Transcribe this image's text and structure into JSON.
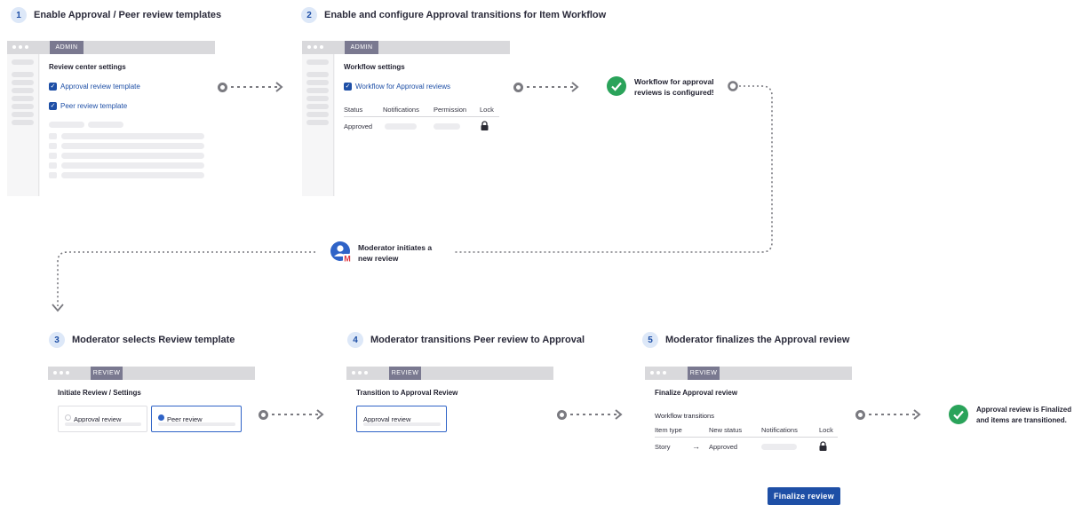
{
  "steps": [
    {
      "num": "1",
      "label": "Enable Approval / Peer review templates"
    },
    {
      "num": "2",
      "label": "Enable and configure Approval transitions for Item Workflow"
    },
    {
      "num": "3",
      "label": "Moderator selects Review template"
    },
    {
      "num": "4",
      "label": "Moderator transitions Peer review to Approval"
    },
    {
      "num": "5",
      "label": "Moderator finalizes the Approval review"
    }
  ],
  "panel1": {
    "tab": "ADMIN",
    "title": "Review center settings",
    "options": [
      "Approval review template",
      "Peer review template"
    ]
  },
  "panel2": {
    "tab": "ADMIN",
    "title": "Workflow settings",
    "option": "Workflow for Approval reviews",
    "columns": [
      "Status",
      "Notifications",
      "Permission",
      "Lock"
    ],
    "row_status": "Approved"
  },
  "notes": {
    "configured": "Workflow for approval reviews is configured!",
    "moderator": "Moderator initiates a new review",
    "finalized": "Approval review is Finalized and items are transitioned."
  },
  "panel3": {
    "tab": "REVIEW",
    "title": "Initiate Review  /  Settings",
    "options": [
      "Approval review",
      "Peer review"
    ],
    "selected": "Peer review"
  },
  "panel4": {
    "tab": "REVIEW",
    "title": "Transition to Approval Review",
    "option": "Approval review"
  },
  "panel5": {
    "tab": "REVIEW",
    "title": "Finalize Approval review",
    "section": "Workflow transitions",
    "columns": [
      "Item type",
      "New status",
      "Notifications",
      "Lock"
    ],
    "row": {
      "item_type": "Story",
      "arrow": "→",
      "new_status": "Approved"
    },
    "button": "Finalize review"
  },
  "icons": [
    "check-circle-icon",
    "user-icon",
    "lock-icon",
    "arrow-right-icon",
    "chevron-down-icon"
  ],
  "colors": {
    "accent": "#1e4fa6",
    "success": "#2aa35a",
    "connector": "#7a7a80",
    "step_badge": "#dde8f8"
  }
}
